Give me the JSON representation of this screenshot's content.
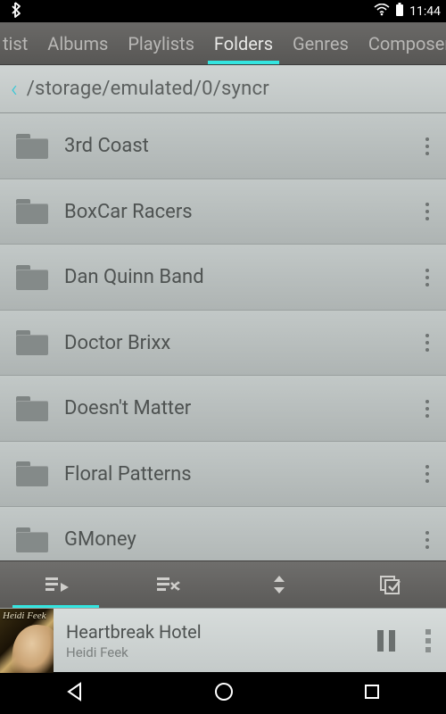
{
  "status": {
    "time": "11:44"
  },
  "tabs": [
    {
      "label": "tist",
      "active": false,
      "cut": "left"
    },
    {
      "label": "Albums",
      "active": false
    },
    {
      "label": "Playlists",
      "active": false
    },
    {
      "label": "Folders",
      "active": true
    },
    {
      "label": "Genres",
      "active": false
    },
    {
      "label": "Composers",
      "active": false,
      "cut": "right"
    }
  ],
  "path": "/storage/emulated/0/syncr",
  "folders": [
    {
      "name": "3rd Coast"
    },
    {
      "name": "BoxCar Racers"
    },
    {
      "name": "Dan Quinn Band"
    },
    {
      "name": "Doctor Brixx"
    },
    {
      "name": "Doesn't Matter"
    },
    {
      "name": "Floral Patterns"
    },
    {
      "name": "GMoney"
    }
  ],
  "nowplaying": {
    "title": "Heartbreak Hotel",
    "artist": "Heidi Feek",
    "cover_label": "Heidi Feek"
  }
}
